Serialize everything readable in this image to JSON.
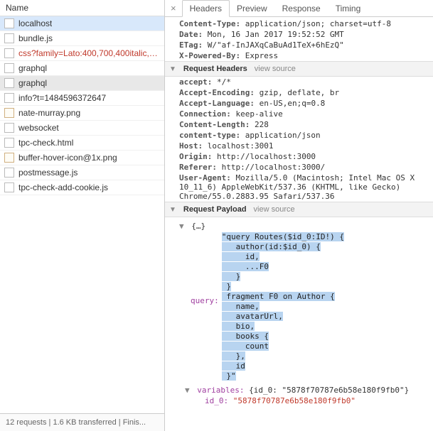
{
  "left": {
    "header": "Name",
    "files": [
      {
        "name": "localhost",
        "cls": "selected-blue",
        "icon": "file"
      },
      {
        "name": "bundle.js",
        "cls": "",
        "icon": "file"
      },
      {
        "name": "css?family=Lato:400,700,400italic,700...",
        "cls": "",
        "icon": "file",
        "red": true
      },
      {
        "name": "graphql",
        "cls": "",
        "icon": "file"
      },
      {
        "name": "graphql",
        "cls": "selected-grey",
        "icon": "file"
      },
      {
        "name": "info?t=1484596372647",
        "cls": "",
        "icon": "file"
      },
      {
        "name": "nate-murray.png",
        "cls": "",
        "icon": "img"
      },
      {
        "name": "websocket",
        "cls": "",
        "icon": "file"
      },
      {
        "name": "tpc-check.html",
        "cls": "",
        "icon": "file"
      },
      {
        "name": "buffer-hover-icon@1x.png",
        "cls": "",
        "icon": "img"
      },
      {
        "name": "postmessage.js",
        "cls": "",
        "icon": "file"
      },
      {
        "name": "tpc-check-add-cookie.js",
        "cls": "",
        "icon": "file"
      }
    ],
    "status": "12 requests  |  1.6 KB transferred  |  Finis..."
  },
  "tabs": {
    "items": [
      "Headers",
      "Preview",
      "Response",
      "Timing"
    ],
    "active": 0
  },
  "response_headers": [
    {
      "k": "Content-Type:",
      "v": "application/json; charset=utf-8"
    },
    {
      "k": "Date:",
      "v": "Mon, 16 Jan 2017 19:52:52 GMT"
    },
    {
      "k": "ETag:",
      "v": "W/\"af-InJAXqCaBuAd1TeX+6hEzQ\""
    },
    {
      "k": "X-Powered-By:",
      "v": "Express"
    }
  ],
  "request_headers_title": "Request Headers",
  "view_source": "view source",
  "request_headers": [
    {
      "k": "accept:",
      "v": "*/*"
    },
    {
      "k": "Accept-Encoding:",
      "v": "gzip, deflate, br"
    },
    {
      "k": "Accept-Language:",
      "v": "en-US,en;q=0.8"
    },
    {
      "k": "Connection:",
      "v": "keep-alive"
    },
    {
      "k": "Content-Length:",
      "v": "228"
    },
    {
      "k": "content-type:",
      "v": "application/json"
    },
    {
      "k": "Host:",
      "v": "localhost:3001"
    },
    {
      "k": "Origin:",
      "v": "http://localhost:3000"
    },
    {
      "k": "Referer:",
      "v": "http://localhost:3000/"
    },
    {
      "k": "User-Agent:",
      "v": "Mozilla/5.0 (Macintosh; Intel Mac OS X 10_11_6) AppleWebKit/537.36 (KHTML, like Gecko) Chrome/55.0.2883.95 Safari/537.36"
    }
  ],
  "payload_title": "Request Payload",
  "payload_toggle": "{…}",
  "query_label": "query:",
  "query_lines": [
    "\"query Routes($id_0:ID!) {",
    "   author(id:$id_0) {",
    "     id,",
    "     ...F0",
    "   }",
    " }",
    " fragment F0 on Author {",
    "   name,",
    "   avatarUrl,",
    "   bio,",
    "   books {",
    "     count",
    "   },",
    "   id",
    " }\""
  ],
  "variables": {
    "label": "variables:",
    "summary": "{id_0: \"5878f70787e6b58e180f9fb0\"}",
    "key": "id_0:",
    "value": "\"5878f70787e6b58e180f9fb0\""
  }
}
